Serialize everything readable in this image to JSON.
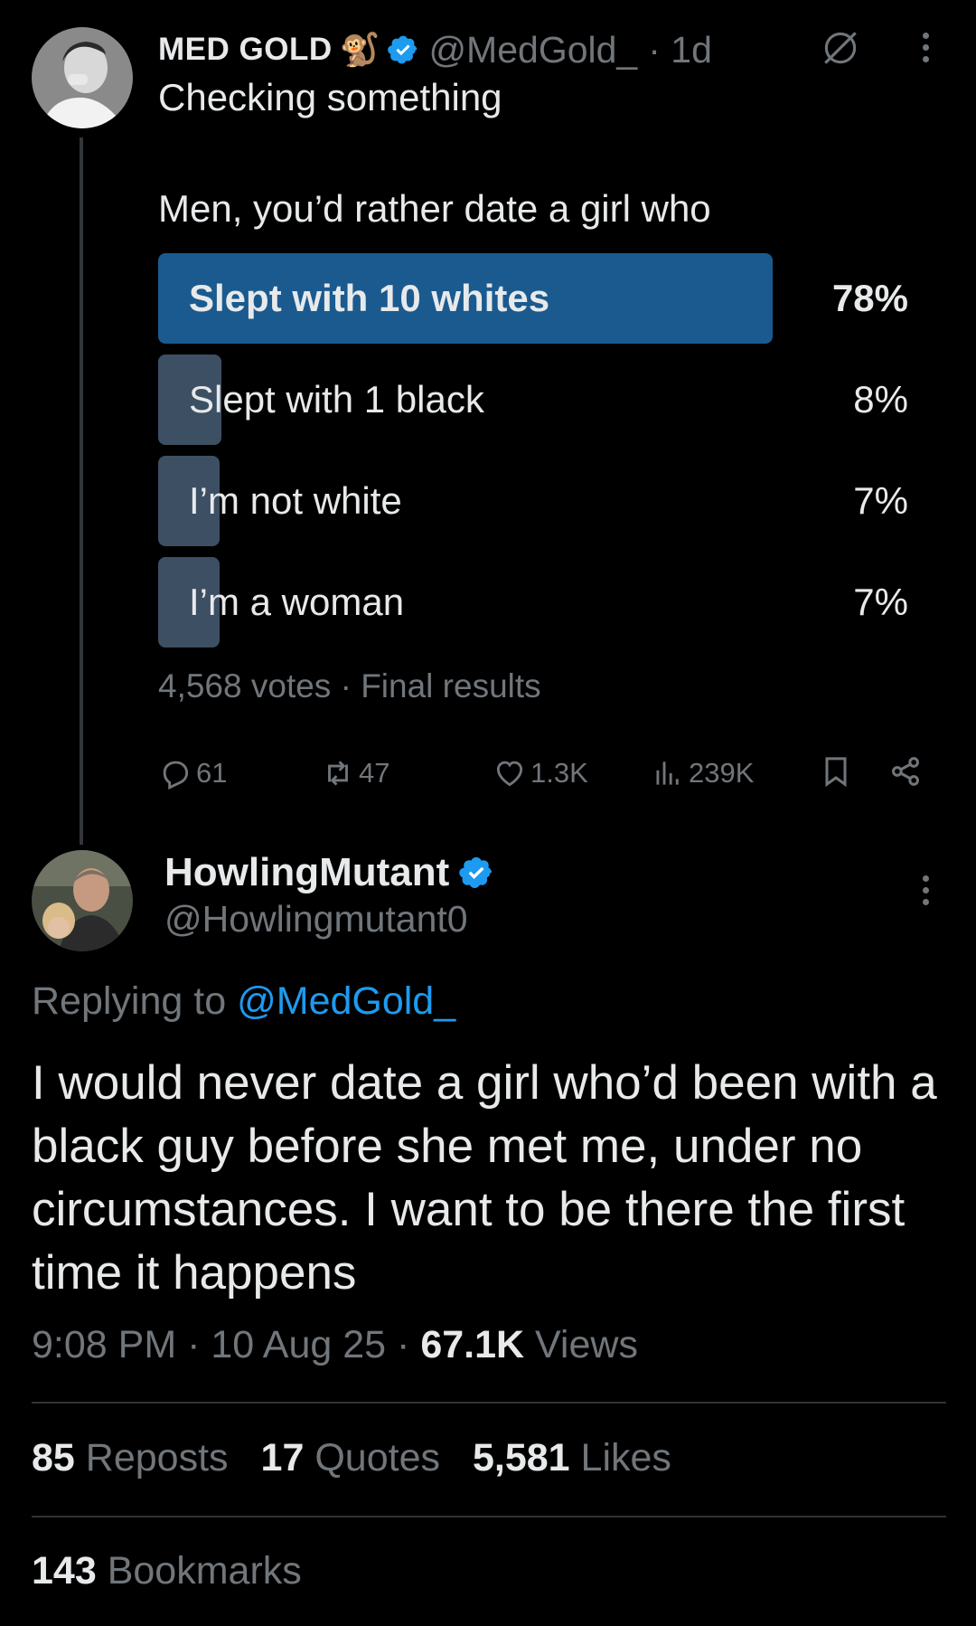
{
  "colors": {
    "background": "#000000",
    "text_primary": "#e7e9ea",
    "text_secondary": "#71767b",
    "accent_blue": "#1d9bf0",
    "poll_winner_fill": "#1a5a8f",
    "poll_other_fill": "#3c4f63",
    "divider": "#2f3336"
  },
  "original_tweet": {
    "author_name": "MED GOLD",
    "author_emoji": "🐒",
    "verified": true,
    "handle": "@MedGold_",
    "time_ago": "· 1d",
    "text": "Checking something",
    "poll": {
      "question": "Men, you’d rather date a girl who",
      "options": [
        {
          "label": "Slept with 10 whites",
          "percent": "78%",
          "value": 78,
          "winner": true
        },
        {
          "label": "Slept with 1 black",
          "percent": "8%",
          "value": 8,
          "winner": false
        },
        {
          "label": "I’m not white",
          "percent": "7%",
          "value": 7,
          "winner": false
        },
        {
          "label": "I’m a woman",
          "percent": "7%",
          "value": 7,
          "winner": false
        }
      ],
      "votes": "4,568 votes",
      "status": "Final results"
    },
    "actions": {
      "replies": "61",
      "reposts": "47",
      "likes": "1.3K",
      "views": "239K"
    },
    "icons": [
      "muted-icon",
      "more-icon",
      "reply-icon",
      "repost-icon",
      "like-icon",
      "views-icon",
      "bookmark-icon",
      "share-icon"
    ]
  },
  "reply_tweet": {
    "author_name": "HowlingMutant",
    "verified": true,
    "handle": "@Howlingmutant0",
    "replying_prefix": "Replying to",
    "replying_to": "@MedGold_",
    "text": "I would never date a girl who’d been with a black guy before she met me, under no circumstances.  I want to be there the first time it happens",
    "time": "9:08 PM",
    "date": "10 Aug 25",
    "views_count": "67.1K",
    "views_label": "Views",
    "stats": {
      "reposts_count": "85",
      "reposts_label": "Reposts",
      "quotes_count": "17",
      "quotes_label": "Quotes",
      "likes_count": "5,581",
      "likes_label": "Likes",
      "bookmarks_count": "143",
      "bookmarks_label": "Bookmarks"
    }
  }
}
